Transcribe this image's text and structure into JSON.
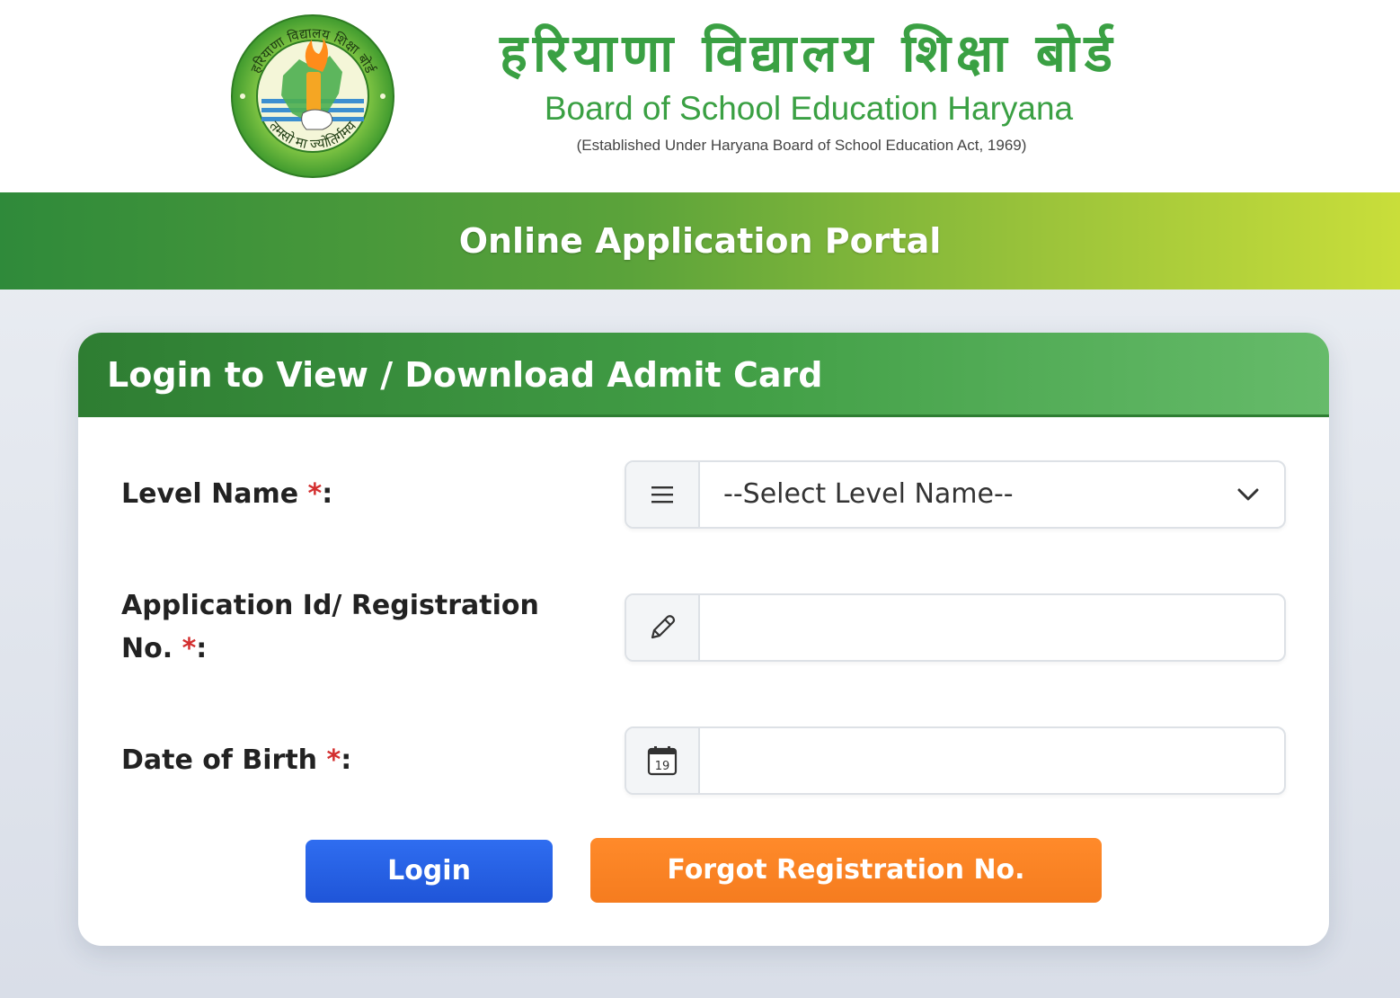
{
  "header": {
    "title_hindi": "हरियाणा विद्यालय शिक्षा बोर्ड",
    "title_english": "Board of School Education Haryana",
    "established": "(Established Under Haryana Board of School Education Act, 1969)",
    "logo": {
      "top_text": "हरियाणा विद्यालय शिक्षा बोर्ड",
      "bottom_text": "तमसो मा ज्योतिर्गमय",
      "icon": "bseh-seal-logo"
    }
  },
  "banner": {
    "title": "Online Application Portal"
  },
  "card": {
    "title": "Login to View / Download Admit Card",
    "fields": {
      "level": {
        "label": "Level Name ",
        "required": "*",
        "colon": ":",
        "value": "--Select Level Name--",
        "icon": "list-icon"
      },
      "application": {
        "label_line1": "Application Id/ Registration",
        "label_line2": "No. ",
        "required": "*",
        "colon": ":",
        "value": "",
        "icon": "pencil-icon"
      },
      "dob": {
        "label": "Date of Birth ",
        "required": "*",
        "colon": ":",
        "value": "",
        "icon": "calendar-icon",
        "calendar_day": "19"
      }
    },
    "buttons": {
      "login": "Login",
      "forgot": "Forgot Registration No."
    }
  },
  "colors": {
    "brand_green": "#3aa043",
    "login_blue": "#2563eb",
    "forgot_orange": "#f57c1f",
    "required_red": "#d32f2f"
  }
}
